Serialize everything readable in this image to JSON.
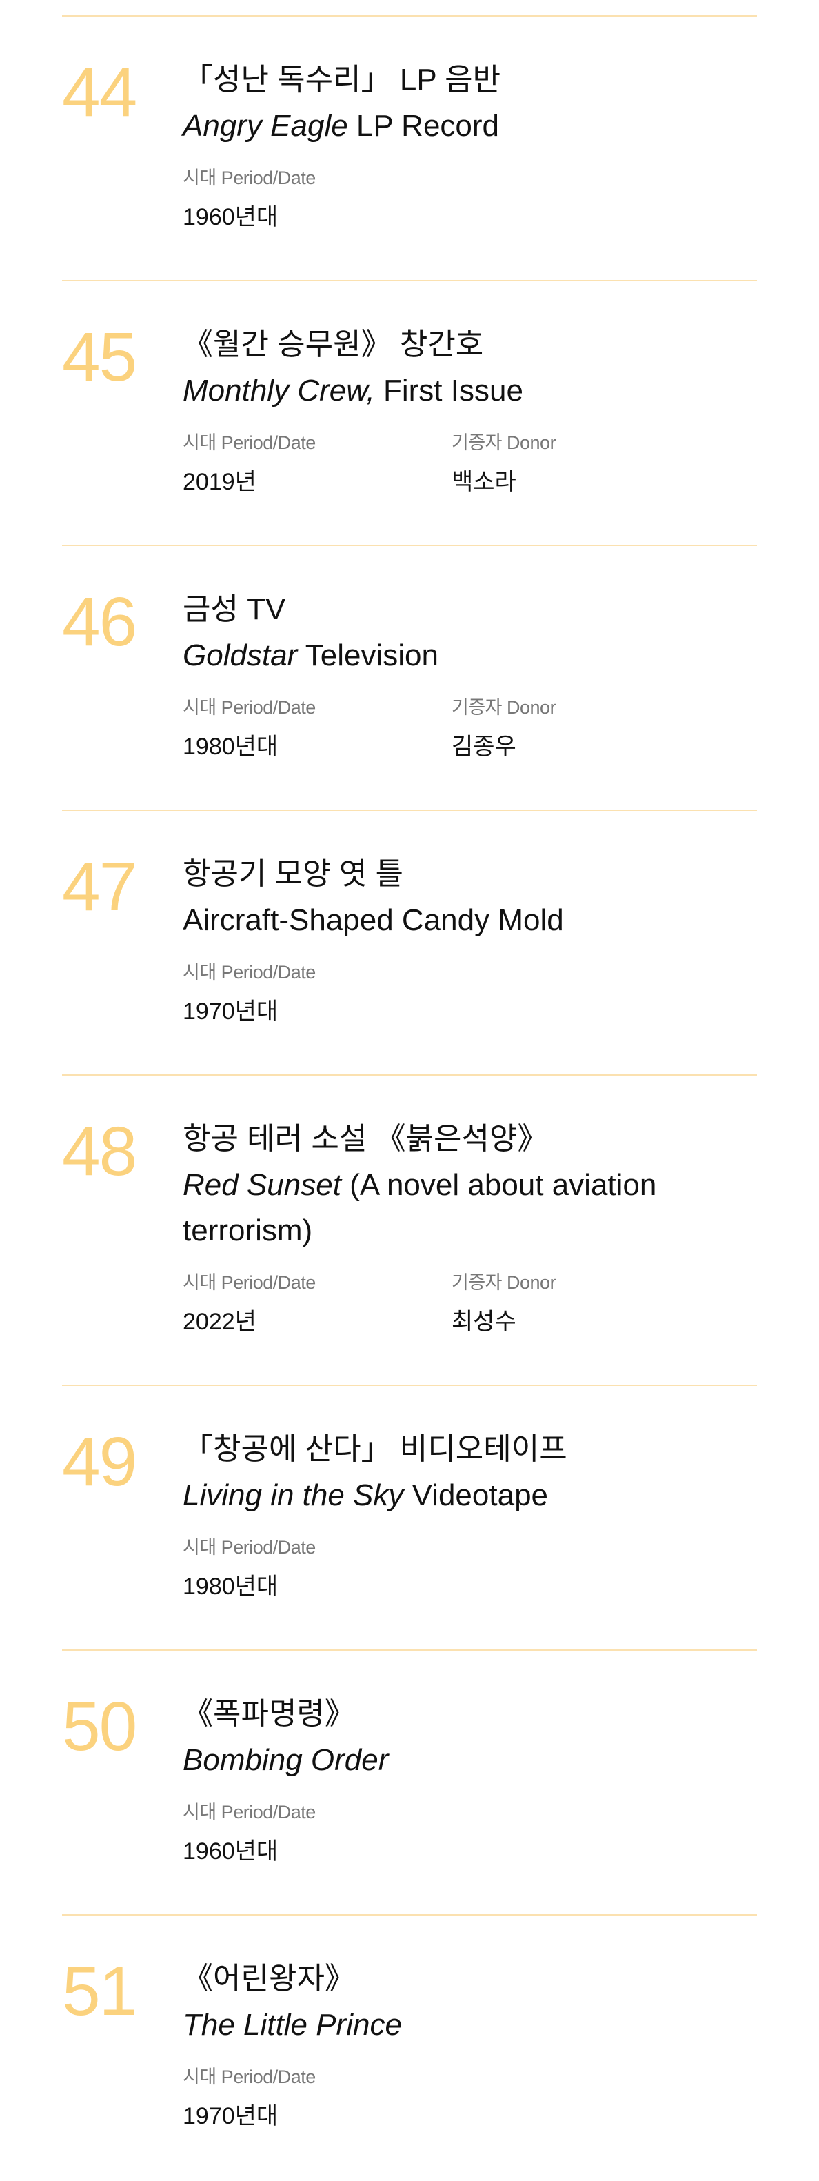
{
  "items": [
    {
      "number": "44",
      "title_ko": "「성난 독수리」 LP 음반",
      "title_en_italic": "Angry Eagle",
      "title_en_rest": " LP Record",
      "period_label": "시대 Period/Date",
      "period_value": "1960년대",
      "donor_label": "",
      "donor_value": ""
    },
    {
      "number": "45",
      "title_ko": "《월간 승무원》 창간호",
      "title_en_italic": "Monthly Crew,",
      "title_en_rest": " First Issue",
      "period_label": "시대 Period/Date",
      "period_value": "2019년",
      "donor_label": "기증자 Donor",
      "donor_value": "백소라"
    },
    {
      "number": "46",
      "title_ko": "금성 TV",
      "title_en_italic": "Goldstar",
      "title_en_rest": " Television",
      "period_label": "시대 Period/Date",
      "period_value": "1980년대",
      "donor_label": "기증자 Donor",
      "donor_value": "김종우"
    },
    {
      "number": "47",
      "title_ko": "항공기 모양 엿 틀",
      "title_en_italic": "",
      "title_en_rest": "Aircraft-Shaped Candy Mold",
      "period_label": "시대 Period/Date",
      "period_value": "1970년대",
      "donor_label": "",
      "donor_value": ""
    },
    {
      "number": "48",
      "title_ko": "항공 테러 소설 《붉은석양》",
      "title_en_italic": "Red Sunset",
      "title_en_rest": " (A novel about aviation terrorism)",
      "period_label": "시대 Period/Date",
      "period_value": "2022년",
      "donor_label": "기증자 Donor",
      "donor_value": "최성수"
    },
    {
      "number": "49",
      "title_ko": "「창공에 산다」 비디오테이프",
      "title_en_italic": "Living in the Sky",
      "title_en_rest": " Videotape",
      "period_label": "시대 Period/Date",
      "period_value": "1980년대",
      "donor_label": "",
      "donor_value": ""
    },
    {
      "number": "50",
      "title_ko": "《폭파명령》",
      "title_en_italic": "Bombing Order",
      "title_en_rest": "",
      "period_label": "시대 Period/Date",
      "period_value": "1960년대",
      "donor_label": "",
      "donor_value": ""
    },
    {
      "number": "51",
      "title_ko": "《어린왕자》",
      "title_en_italic": "The Little Prince",
      "title_en_rest": "",
      "period_label": "시대 Period/Date",
      "period_value": "1970년대",
      "donor_label": "",
      "donor_value": ""
    }
  ],
  "colors": {
    "number": "#fbd27e",
    "divider": "#fbe1b0",
    "label": "#777777",
    "text": "#111111"
  }
}
